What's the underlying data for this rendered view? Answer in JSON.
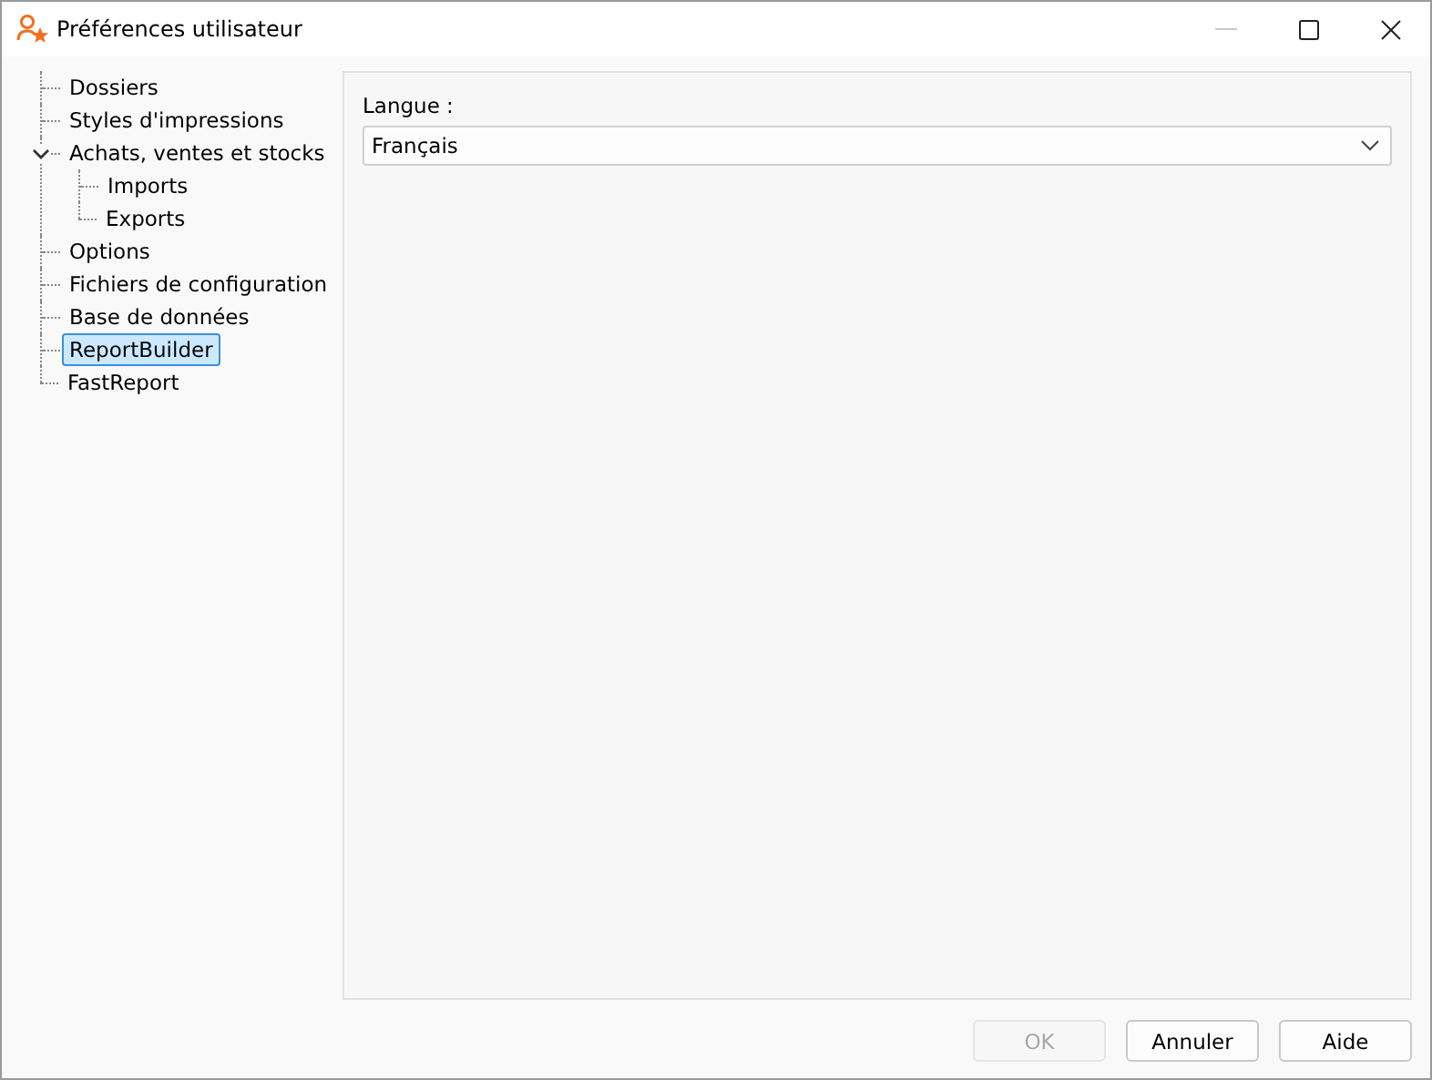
{
  "window": {
    "title": "Préférences utilisateur"
  },
  "tree": [
    {
      "label": "Dossiers",
      "selected": false
    },
    {
      "label": "Styles d'impressions",
      "selected": false
    },
    {
      "label": "Achats, ventes et stocks",
      "selected": false,
      "expanded": true,
      "children": [
        {
          "label": "Imports",
          "selected": false
        },
        {
          "label": "Exports",
          "selected": false
        }
      ]
    },
    {
      "label": "Options",
      "selected": false
    },
    {
      "label": "Fichiers de configuration",
      "selected": false
    },
    {
      "label": "Base de données",
      "selected": false
    },
    {
      "label": "ReportBuilder",
      "selected": true
    },
    {
      "label": "FastReport",
      "selected": false
    }
  ],
  "panel": {
    "label": "Langue :",
    "value": "Français"
  },
  "buttons": [
    {
      "label": "OK",
      "disabled": true
    },
    {
      "label": "Annuler",
      "disabled": false
    },
    {
      "label": "Aide",
      "disabled": false
    }
  ]
}
